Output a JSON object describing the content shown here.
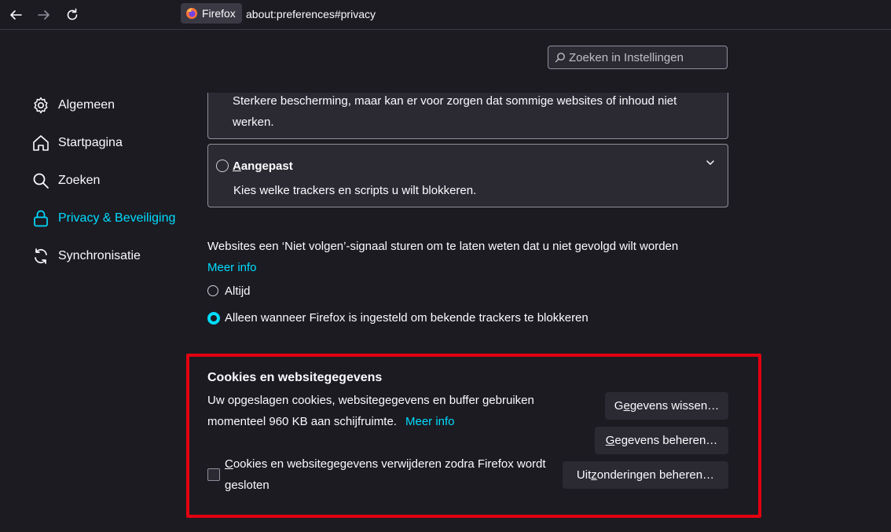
{
  "browser": {
    "identity_label": "Firefox",
    "url": "about:preferences#privacy"
  },
  "search": {
    "placeholder": "Zoeken in Instellingen"
  },
  "sidebar": {
    "items": [
      {
        "label": "Algemeen",
        "icon": "gear-icon"
      },
      {
        "label": "Startpagina",
        "icon": "home-icon"
      },
      {
        "label": "Zoeken",
        "icon": "search-icon"
      },
      {
        "label": "Privacy & Beveiliging",
        "icon": "lock-icon",
        "active": true
      },
      {
        "label": "Synchronisatie",
        "icon": "sync-icon"
      }
    ]
  },
  "tracking": {
    "strict_desc_line1": "Sterkere bescherming, maar kan er voor zorgen dat sommige websites of inhoud niet",
    "strict_desc_line2": "werken.",
    "custom_title_first": "A",
    "custom_title_rest": "angepast",
    "custom_desc": "Kies welke trackers en scripts u wilt blokkeren."
  },
  "dnt": {
    "text": "Websites een ‘Niet volgen’-signaal sturen om te laten weten dat u niet gevolgd wilt worden",
    "more_info": "Meer info",
    "option_always": "Altijd",
    "option_only": "Alleen wanneer Firefox is ingesteld om bekende trackers te blokkeren",
    "selected": "option_only"
  },
  "cookies": {
    "heading": "Cookies en websitegegevens",
    "desc_line1": "Uw opgeslagen cookies, websitegegevens en buffer gebruiken",
    "desc_line2": "momenteel 960 KB aan schijfruimte.",
    "more_info": "Meer info",
    "clear_button": {
      "pre": "G",
      "accel": "e",
      "post": "gevens wissen…"
    },
    "manage_button": {
      "pre": "",
      "accel": "G",
      "post": "egevens beheren…"
    },
    "exceptions_button": {
      "pre": "Uit",
      "accel": "z",
      "post": "onderingen beheren…"
    },
    "delete_on_close_first": "C",
    "delete_on_close_line1_rest": "ookies en websitegegevens verwijderen zodra Firefox wordt",
    "delete_on_close_line2": "gesloten",
    "delete_on_close_checked": false
  },
  "colors": {
    "accent": "#00ddff",
    "highlight": "#e3000f",
    "background": "#1c1b22",
    "panel": "#2b2a33"
  }
}
